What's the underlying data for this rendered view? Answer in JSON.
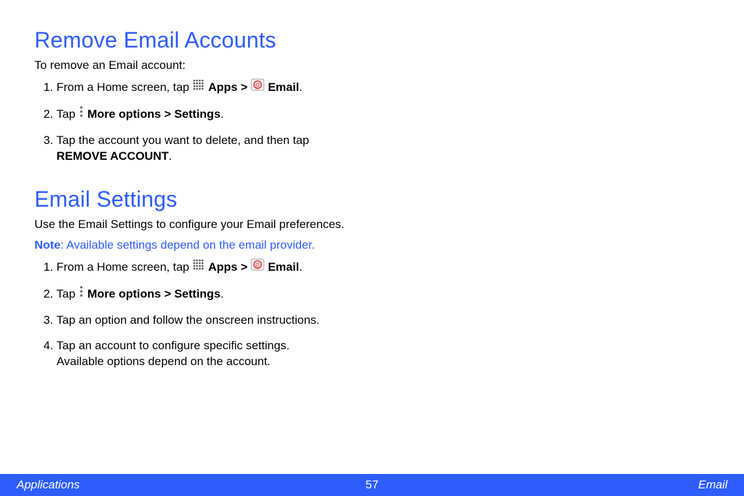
{
  "section1": {
    "heading": "Remove Email Accounts",
    "intro": "To remove an Email account:",
    "step1_a": "From a Home screen, tap ",
    "step1_apps": "Apps > ",
    "step1_email": " Email",
    "step1_period": ".",
    "step2_a": "Tap ",
    "step2_b": "More options > Settings",
    "step2_period": ".",
    "step3_a": "Tap the account you want to delete, and then tap ",
    "step3_b": "REMOVE ACCOUNT",
    "step3_period": "."
  },
  "section2": {
    "heading": "Email Settings",
    "intro": "Use the Email Settings to configure your Email preferences.",
    "note_label": "Note",
    "note_sep": ": ",
    "note_body": "Available settings depend on the email provider.",
    "step1_a": "From a Home screen, tap ",
    "step1_apps": "Apps > ",
    "step1_email": " Email",
    "step1_period": ".",
    "step2_a": "Tap ",
    "step2_b": "More options > Settings",
    "step2_period": ".",
    "step3": "Tap an option and follow the onscreen instructions.",
    "step4_a": "Tap an account to configure specific settings. ",
    "step4_b": "Available options depend on the account."
  },
  "footer": {
    "left": "Applications",
    "center": "57",
    "right": "Email"
  }
}
